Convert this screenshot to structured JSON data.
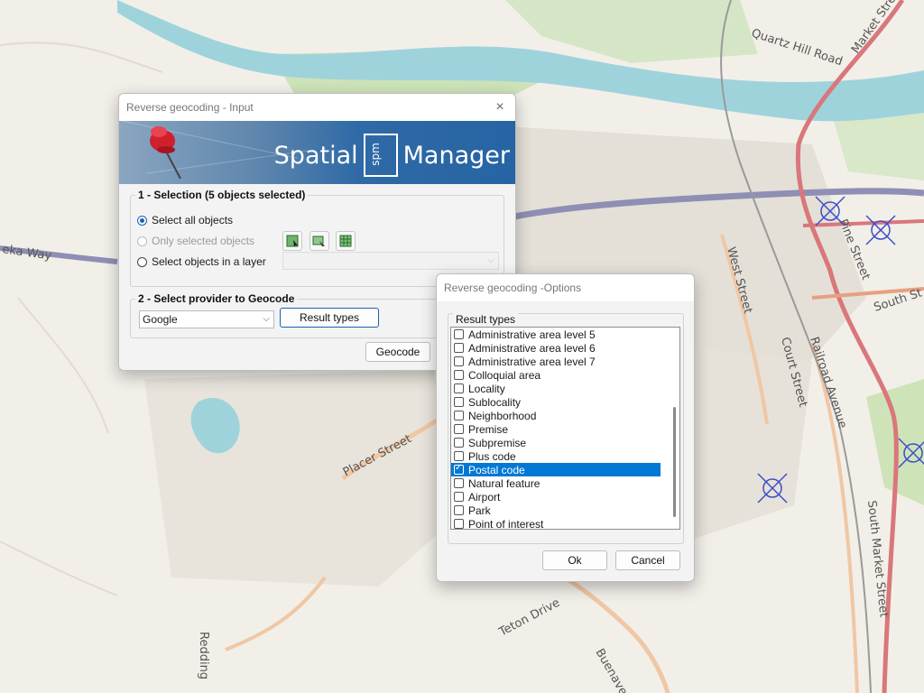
{
  "map": {
    "street_labels": [
      "Quartz Hill Road",
      "Market Street",
      "eka Way",
      "West Street",
      "Pine Street",
      "South St",
      "Court Street",
      "Railroad Avenue",
      "Placer Street",
      "South Market Street",
      "Teton Drive",
      "Buenave",
      "Redding"
    ]
  },
  "input_dialog": {
    "title": "Reverse geocoding - Input",
    "close_symbol": "×",
    "brand_left": "Spatial",
    "brand_box": "spm",
    "brand_right": "Manager",
    "section1_label": "1 - Selection (5 objects selected)",
    "radio_all": "Select all objects",
    "radio_selected": "Only selected objects",
    "radio_layer": "Select objects in a layer",
    "layer_combo_value": "",
    "section2_label": "2 - Select provider to Geocode",
    "provider_value": "Google",
    "result_types_button": "Result types",
    "geocode_button": "Geocode"
  },
  "options_dialog": {
    "title": "Reverse geocoding -Options",
    "group_label": "Result types",
    "items": [
      {
        "label": "Administrative area level 5",
        "checked": false,
        "selected": false
      },
      {
        "label": "Administrative area level 6",
        "checked": false,
        "selected": false
      },
      {
        "label": "Administrative area level 7",
        "checked": false,
        "selected": false
      },
      {
        "label": "Colloquial area",
        "checked": false,
        "selected": false
      },
      {
        "label": "Locality",
        "checked": false,
        "selected": false
      },
      {
        "label": "Sublocality",
        "checked": false,
        "selected": false
      },
      {
        "label": "Neighborhood",
        "checked": false,
        "selected": false
      },
      {
        "label": "Premise",
        "checked": false,
        "selected": false
      },
      {
        "label": "Subpremise",
        "checked": false,
        "selected": false
      },
      {
        "label": "Plus code",
        "checked": false,
        "selected": false
      },
      {
        "label": "Postal code",
        "checked": true,
        "selected": true
      },
      {
        "label": "Natural feature",
        "checked": false,
        "selected": false
      },
      {
        "label": "Airport",
        "checked": false,
        "selected": false
      },
      {
        "label": "Park",
        "checked": false,
        "selected": false
      },
      {
        "label": "Point of interest",
        "checked": false,
        "selected": false
      }
    ],
    "ok_button": "Ok",
    "cancel_button": "Cancel"
  },
  "colors": {
    "accent": "#0078d4",
    "river": "#9fd3dc",
    "major_road": "#d9777a",
    "highway": "#8f8fb5"
  }
}
